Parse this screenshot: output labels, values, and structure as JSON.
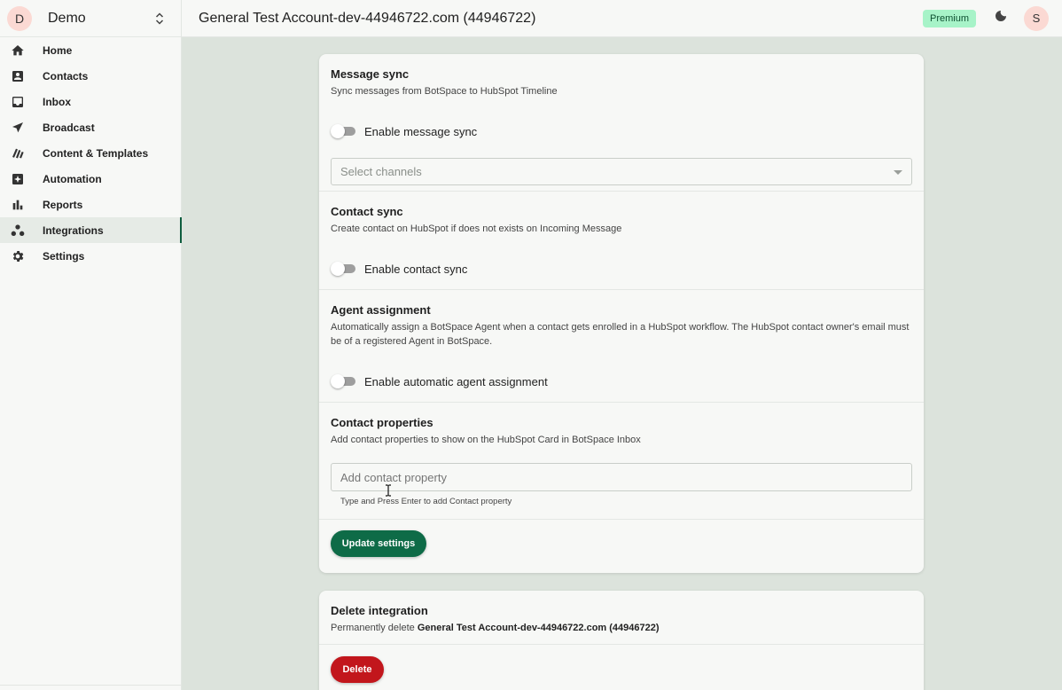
{
  "workspace": {
    "initial": "D",
    "name": "Demo"
  },
  "nav": {
    "items": [
      {
        "label": "Home",
        "icon": "home-icon"
      },
      {
        "label": "Contacts",
        "icon": "contacts-icon"
      },
      {
        "label": "Inbox",
        "icon": "inbox-icon"
      },
      {
        "label": "Broadcast",
        "icon": "send-icon"
      },
      {
        "label": "Content & Templates",
        "icon": "templates-icon"
      },
      {
        "label": "Automation",
        "icon": "automation-icon"
      },
      {
        "label": "Reports",
        "icon": "bar-chart-icon"
      },
      {
        "label": "Integrations",
        "icon": "integrations-icon",
        "active": true
      },
      {
        "label": "Settings",
        "icon": "gear-icon"
      }
    ]
  },
  "header": {
    "title": "General Test Account-dev-44946722.com (44946722)",
    "plan_badge": "Premium",
    "user_initial": "S"
  },
  "message_sync": {
    "title": "Message sync",
    "description": "Sync messages from BotSpace to HubSpot Timeline",
    "toggle_label": "Enable message sync",
    "toggle_on": false,
    "channels_placeholder": "Select channels"
  },
  "contact_sync": {
    "title": "Contact sync",
    "description": "Create contact on HubSpot if does not exists on Incoming Message",
    "toggle_label": "Enable contact sync",
    "toggle_on": false
  },
  "agent_assignment": {
    "title": "Agent assignment",
    "description": "Automatically assign a BotSpace Agent when a contact gets enrolled in a HubSpot workflow. The HubSpot contact owner's email must be of a registered Agent in BotSpace.",
    "toggle_label": "Enable automatic agent assignment",
    "toggle_on": false
  },
  "contact_properties": {
    "title": "Contact properties",
    "description": "Add contact properties to show on the HubSpot Card in BotSpace Inbox",
    "input_placeholder": "Add contact property",
    "helper_text": "Type and Press Enter to add Contact property"
  },
  "update_button": "Update settings",
  "delete_integration": {
    "title": "Delete integration",
    "description_prefix": "Permanently delete ",
    "entity": "General Test Account-dev-44946722.com (44946722)",
    "button": "Delete"
  },
  "colors": {
    "primary": "#0e6b47",
    "danger": "#c2161c",
    "premium_bg": "#a7f3c8",
    "page_bg": "#dce3dc"
  }
}
